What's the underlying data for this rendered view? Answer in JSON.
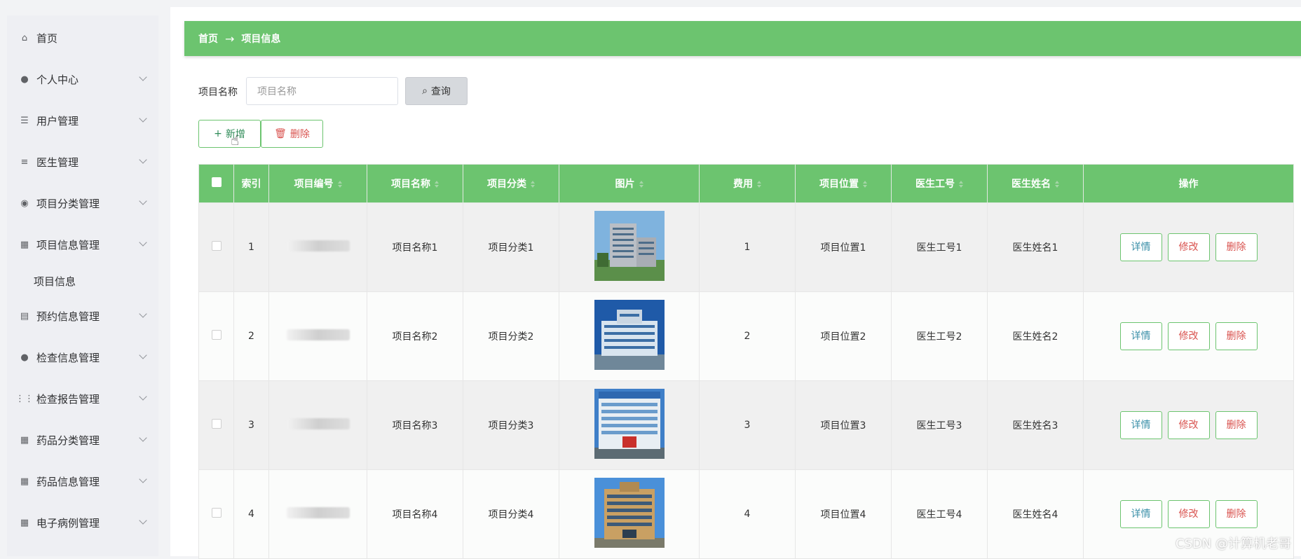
{
  "sidebar": {
    "items": [
      {
        "label": "首页",
        "icon": "home-icon",
        "expandable": false
      },
      {
        "label": "个人中心",
        "icon": "user-icon",
        "expandable": true
      },
      {
        "label": "用户管理",
        "icon": "sliders-icon",
        "expandable": true
      },
      {
        "label": "医生管理",
        "icon": "list-icon",
        "expandable": true
      },
      {
        "label": "项目分类管理",
        "icon": "location-icon",
        "expandable": true
      },
      {
        "label": "项目信息管理",
        "icon": "grid-icon",
        "expandable": true
      },
      {
        "label": "预约信息管理",
        "icon": "clipboard-icon",
        "expandable": true
      },
      {
        "label": "检查信息管理",
        "icon": "user-icon",
        "expandable": true
      },
      {
        "label": "检查报告管理",
        "icon": "grid9-icon",
        "expandable": true
      },
      {
        "label": "药品分类管理",
        "icon": "grid-icon",
        "expandable": true
      },
      {
        "label": "药品信息管理",
        "icon": "grid-icon",
        "expandable": true
      },
      {
        "label": "电子病例管理",
        "icon": "grid-icon",
        "expandable": true
      }
    ],
    "sub_item": "项目信息"
  },
  "breadcrumb": {
    "home": "首页",
    "separator": "→",
    "current": "项目信息"
  },
  "search": {
    "label": "项目名称",
    "placeholder": "项目名称",
    "button": "查询"
  },
  "toolbar": {
    "add": "新增",
    "delete": "删除"
  },
  "table": {
    "headers": [
      "索引",
      "项目编号",
      "项目名称",
      "项目分类",
      "图片",
      "费用",
      "项目位置",
      "医生工号",
      "医生姓名",
      "操作"
    ],
    "rows": [
      {
        "index": "1",
        "name": "项目名称1",
        "category": "项目分类1",
        "fee": "1",
        "location": "项目位置1",
        "doctor_id": "医生工号1",
        "doctor_name": "医生姓名1"
      },
      {
        "index": "2",
        "name": "项目名称2",
        "category": "项目分类2",
        "fee": "2",
        "location": "项目位置2",
        "doctor_id": "医生工号2",
        "doctor_name": "医生姓名2"
      },
      {
        "index": "3",
        "name": "项目名称3",
        "category": "项目分类3",
        "fee": "3",
        "location": "项目位置3",
        "doctor_id": "医生工号3",
        "doctor_name": "医生姓名3"
      },
      {
        "index": "4",
        "name": "项目名称4",
        "category": "项目分类4",
        "fee": "4",
        "location": "项目位置4",
        "doctor_id": "医生工号4",
        "doctor_name": "医生姓名4"
      }
    ],
    "actions": {
      "detail": "详情",
      "edit": "修改",
      "delete": "删除"
    }
  },
  "watermark": "CSDN @计算机老哥",
  "colors": {
    "accent": "#6cc46f",
    "danger": "#d9534f",
    "info": "#3a8fa8"
  }
}
